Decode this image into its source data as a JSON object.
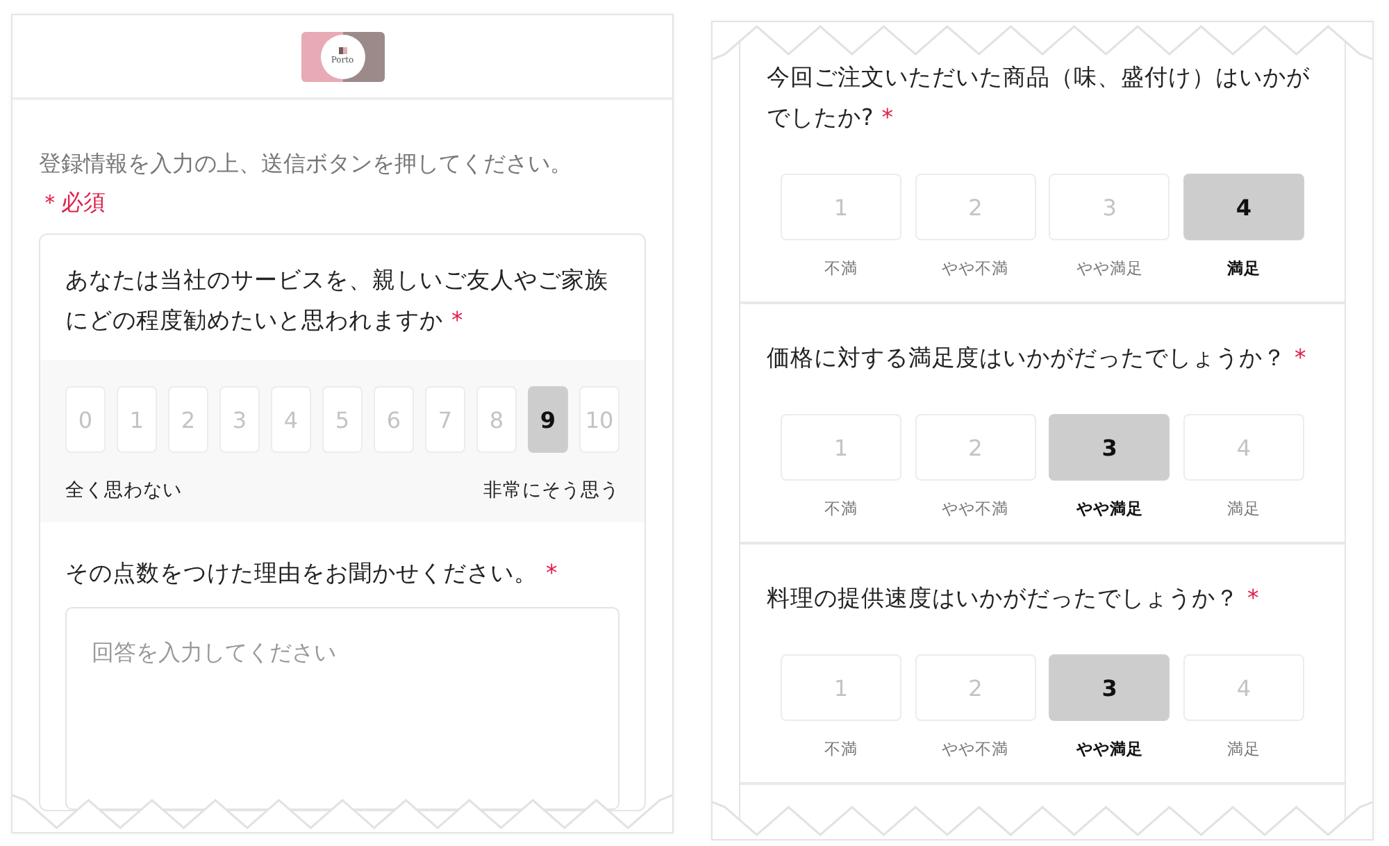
{
  "left_panel": {
    "logo": {
      "text": "Porto"
    },
    "intro": "登録情報を入力の上、送信ボタンを押してください。",
    "required_note": "＊必須",
    "nps_question": {
      "text": "あなたは当社のサービスを、親しいご友人やご家族にどの程度勧めたいと思われますか",
      "mark": "*",
      "scale": [
        {
          "label": "0",
          "selected": false
        },
        {
          "label": "1",
          "selected": false
        },
        {
          "label": "2",
          "selected": false
        },
        {
          "label": "3",
          "selected": false
        },
        {
          "label": "4",
          "selected": false
        },
        {
          "label": "5",
          "selected": false
        },
        {
          "label": "6",
          "selected": false
        },
        {
          "label": "7",
          "selected": false
        },
        {
          "label": "8",
          "selected": false
        },
        {
          "label": "9",
          "selected": true
        },
        {
          "label": "10",
          "selected": false
        }
      ],
      "low_label": "全く思わない",
      "high_label": "非常にそう思う"
    },
    "reason_question": {
      "text": "その点数をつけた理由をお聞かせください。",
      "mark": "*",
      "placeholder": "回答を入力してください"
    }
  },
  "right_panel": {
    "questions": [
      {
        "text": "今回ご注文いただいた商品（味、盛付け）はいかがでしたか?",
        "mark": "*",
        "options": [
          {
            "number": "1",
            "label": "不満",
            "selected": false
          },
          {
            "number": "2",
            "label": "やや不満",
            "selected": false
          },
          {
            "number": "3",
            "label": "やや満足",
            "selected": false
          },
          {
            "number": "4",
            "label": "満足",
            "selected": true
          }
        ]
      },
      {
        "text": "価格に対する満足度はいかがだったでしょうか？",
        "mark": "*",
        "options": [
          {
            "number": "1",
            "label": "不満",
            "selected": false
          },
          {
            "number": "2",
            "label": "やや不満",
            "selected": false
          },
          {
            "number": "3",
            "label": "やや満足",
            "selected": true
          },
          {
            "number": "4",
            "label": "満足",
            "selected": false
          }
        ]
      },
      {
        "text": "料理の提供速度はいかがだったでしょうか？",
        "mark": "*",
        "options": [
          {
            "number": "1",
            "label": "不満",
            "selected": false
          },
          {
            "number": "2",
            "label": "やや不満",
            "selected": false
          },
          {
            "number": "3",
            "label": "やや満足",
            "selected": true
          },
          {
            "number": "4",
            "label": "満足",
            "selected": false
          }
        ]
      }
    ]
  }
}
